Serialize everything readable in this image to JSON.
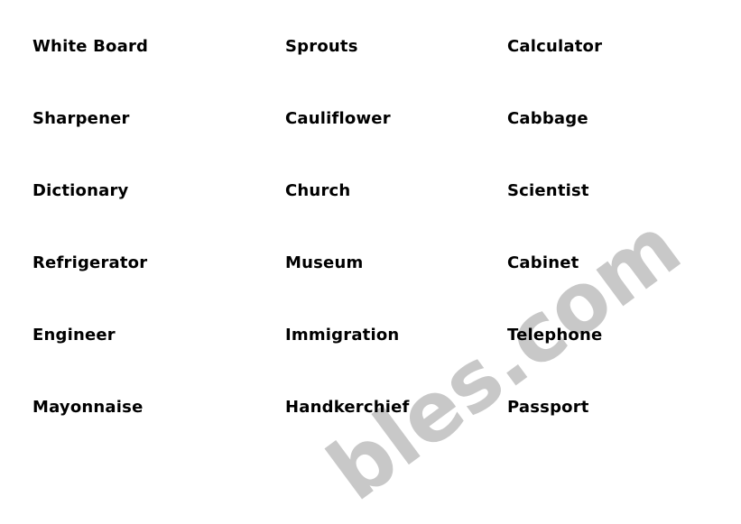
{
  "columns": [
    [
      "White Board",
      "Sharpener",
      "Dictionary",
      "Refrigerator",
      "Engineer",
      "Mayonnaise"
    ],
    [
      "Sprouts",
      "Cauliflower",
      "Church",
      "Museum",
      "Immigration",
      "Handkerchief"
    ],
    [
      "Calculator",
      "Cabbage",
      "Scientist",
      "Cabinet",
      "Telephone",
      "Passport"
    ]
  ],
  "watermark": {
    "text": "eslprintables.com",
    "color": "#c8c8c8"
  }
}
